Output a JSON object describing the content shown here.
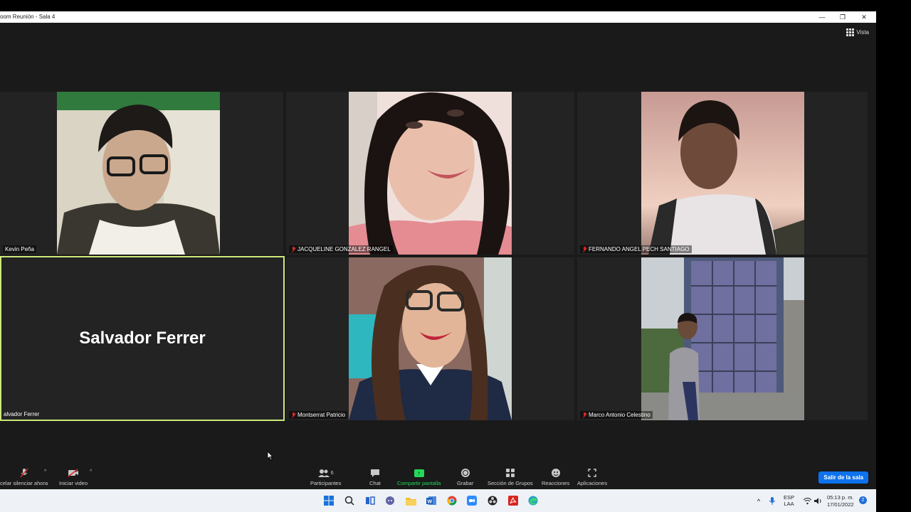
{
  "window": {
    "title": "oom Reunión - Sala 4"
  },
  "view": {
    "label": "Vista"
  },
  "tiles": [
    {
      "name": "Kevin Peña",
      "muted": false
    },
    {
      "name": "JACQUELINE GONZALEZ RANGEL",
      "muted": true
    },
    {
      "name": "FERNANDO ANGEL PECH SANTIAGO",
      "muted": true
    },
    {
      "name": "alvador Ferrer",
      "display_name": "Salvador Ferrer",
      "muted": false,
      "active_speaker": true
    },
    {
      "name": "Montserrat Patricio",
      "muted": true
    },
    {
      "name": "Marco Antonio Celestino",
      "muted": true
    }
  ],
  "toolbar": {
    "audio_label": "celar silenciar ahora",
    "video_label": "Iniciar video",
    "participants_label": "Participantes",
    "participants_count": "6",
    "chat_label": "Chat",
    "share_label": "Compartir pantalla",
    "record_label": "Grabar",
    "breakout_label": "Sección de Grupos",
    "reactions_label": "Reacciones",
    "apps_label": "Aplicaciones",
    "leave_label": "Salir de la sala"
  },
  "taskbar": {
    "lang_top": "ESP",
    "lang_bottom": "LAA",
    "time": "05:13 p. m.",
    "date": "17/01/2022",
    "notifications": "2"
  },
  "colors": {
    "accent": "#0e72ed",
    "share": "#23d959",
    "active_border": "#cde87a",
    "muted": "#e02828"
  }
}
